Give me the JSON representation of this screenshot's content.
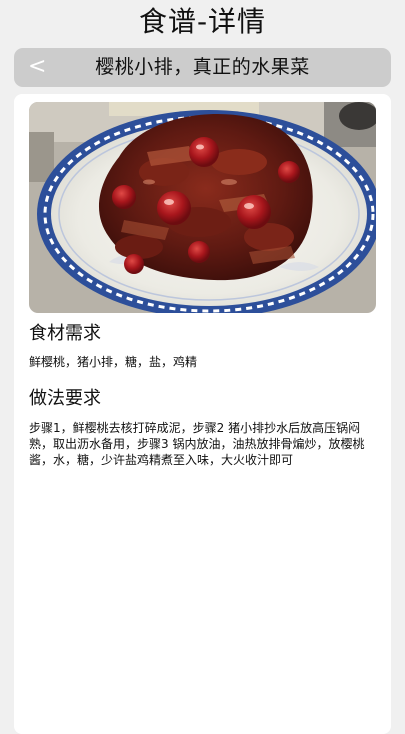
{
  "header": {
    "title": "食谱-详情"
  },
  "navbar": {
    "back_label": "<",
    "title": "樱桃小排，真正的水果菜"
  },
  "recipe": {
    "photo_icon": "dish-photo",
    "ingredients_heading": "食材需求",
    "ingredients": "鲜樱桃，猪小排，糖，盐，鸡精",
    "method_heading": "做法要求",
    "method": "步骤1，鲜樱桃去核打碎成泥，步骤2 猪小排抄水后放高压锅闷熟，取出沥水备用，步骤3 锅内放油，油热放排骨煸炒，放樱桃酱，水，糖，少许盐鸡精煮至入味，大火收汁即可"
  },
  "colors": {
    "background": "#f0f0f0",
    "navbar": "#cccccc",
    "card": "#ffffff",
    "plate_rim": "#2d4f9a",
    "sauce": "#5a1410"
  }
}
